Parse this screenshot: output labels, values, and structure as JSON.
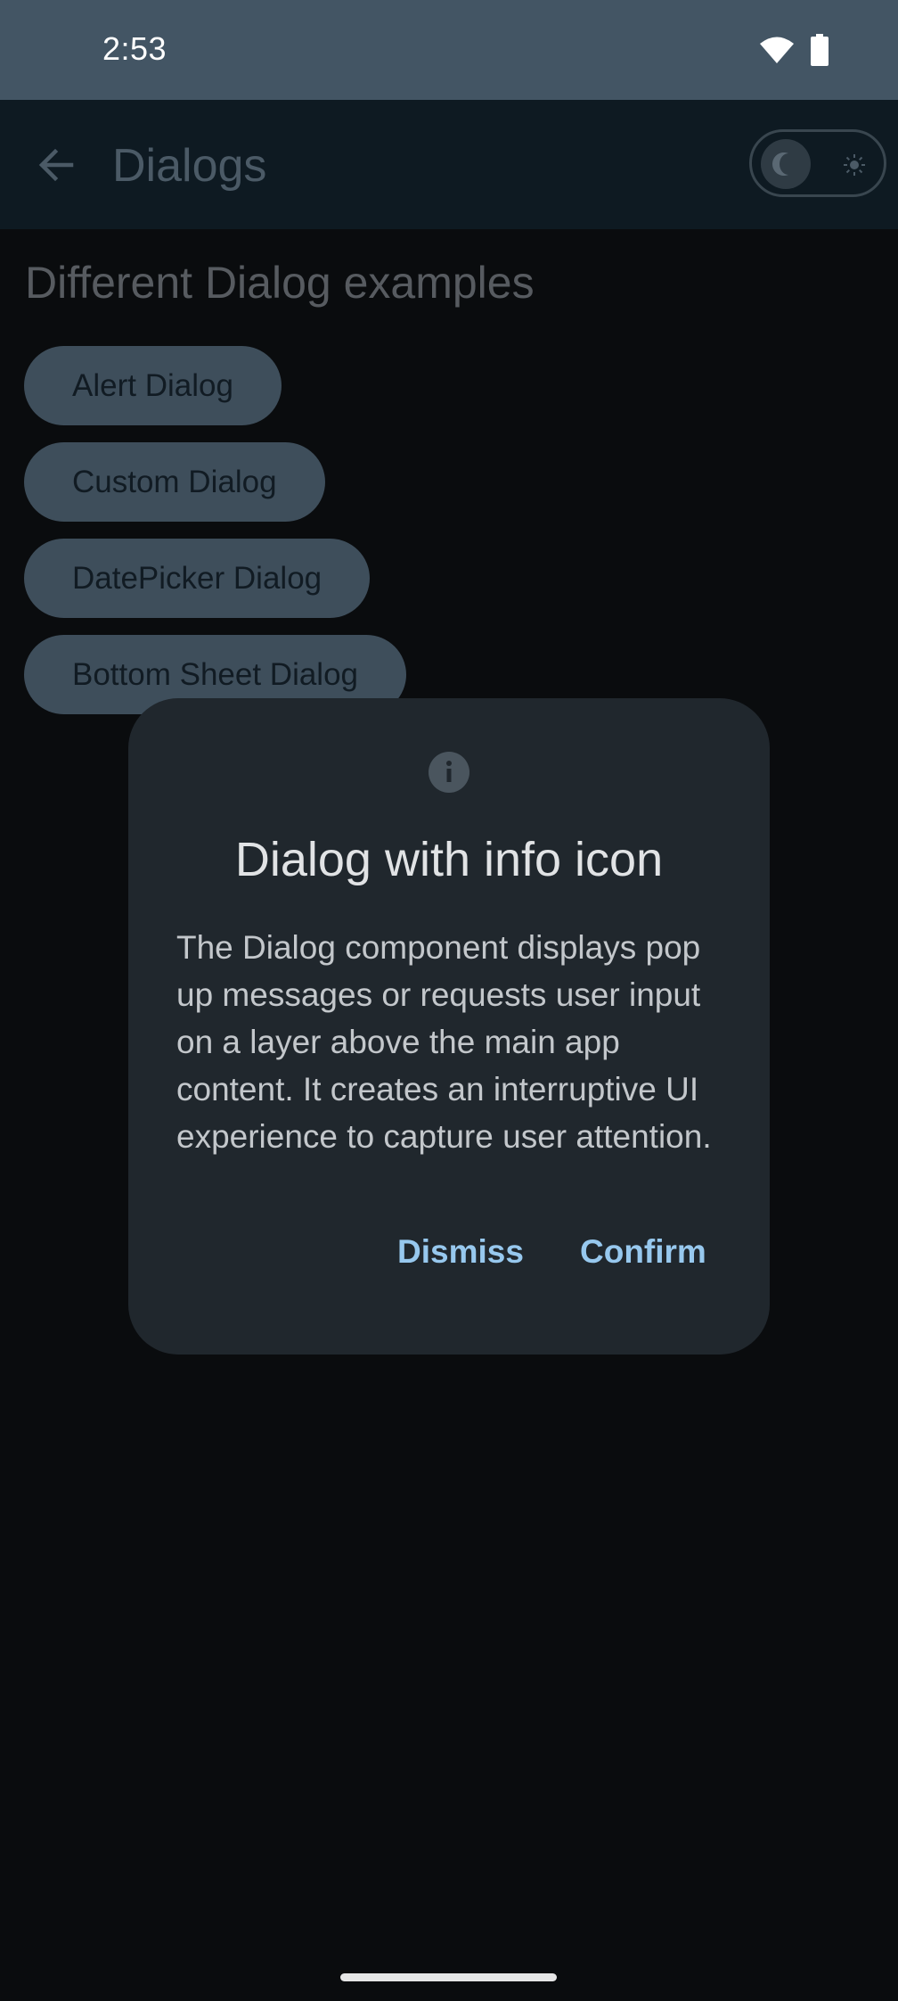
{
  "status_bar": {
    "time": "2:53",
    "icons": [
      "wifi-icon",
      "battery-icon"
    ],
    "color": "#435564"
  },
  "app_bar": {
    "title": "Dialogs",
    "back_icon": "arrow-back-icon",
    "toggle": {
      "knob_icon": "moon-icon",
      "alt_icon": "sun-icon",
      "mode": "dark"
    }
  },
  "main": {
    "section_title": "Different Dialog examples",
    "buttons": [
      {
        "label": "Alert Dialog"
      },
      {
        "label": "Custom Dialog"
      },
      {
        "label": "DatePicker Dialog"
      },
      {
        "label": "Bottom Sheet Dialog"
      }
    ]
  },
  "dialog": {
    "icon": "info-icon",
    "title": "Dialog with info icon",
    "body": "The Dialog component displays pop up messages or requests user input on a layer above the main app content. It creates an interruptive UI experience to capture user attention.",
    "dismiss_label": "Dismiss",
    "confirm_label": "Confirm",
    "accent_color": "#97c8ee"
  }
}
